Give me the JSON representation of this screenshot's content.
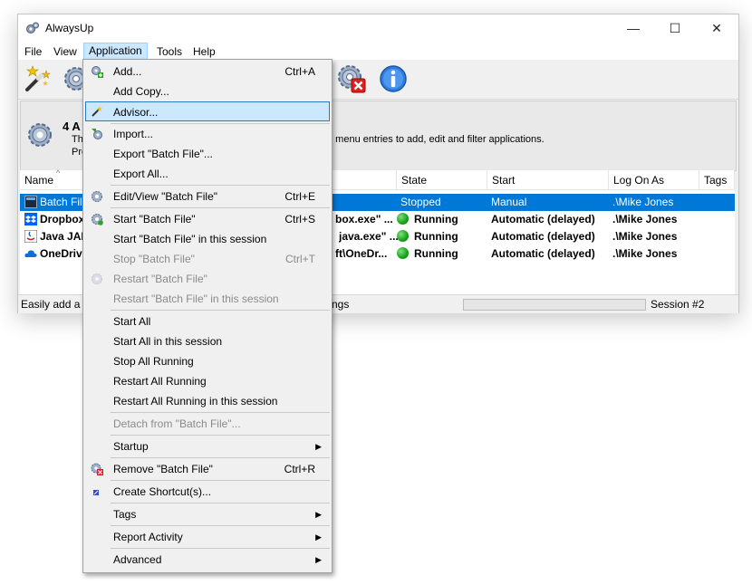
{
  "window": {
    "title": "AlwaysUp",
    "controls": [
      "—",
      "☐",
      "✕"
    ]
  },
  "menubar": [
    "File",
    "View",
    "Application",
    "Tools",
    "Help"
  ],
  "toolbar_icons": [
    "magic-wand-icon",
    "gear-add-icon",
    "gear-remove-icon",
    "info-icon"
  ],
  "info_panel": {
    "title": "4 A",
    "line1": "Th",
    "line2": "Pre",
    "text": "d menu entries to add, edit and filter applications."
  },
  "list": {
    "columns": [
      "Name",
      "State",
      "Start",
      "Log On As",
      "Tags"
    ],
    "rows": [
      {
        "name": "Batch File",
        "mid": "",
        "state": "Stopped",
        "start": "Manual",
        "logon": ".\\Mike Jones",
        "running": false
      },
      {
        "name": "Dropbox",
        "mid": "box.exe\" ...",
        "state": "Running",
        "start": "Automatic (delayed)",
        "logon": ".\\Mike Jones",
        "running": true
      },
      {
        "name": "Java JAR",
        "mid": "java.exe\" ...",
        "state": "Running",
        "start": "Automatic (delayed)",
        "logon": ".\\Mike Jones",
        "running": true
      },
      {
        "name": "OneDriv",
        "mid": "ft\\OneDr...",
        "state": "Running",
        "start": "Automatic (delayed)",
        "logon": ".\\Mike Jones",
        "running": true
      }
    ]
  },
  "statusbar": {
    "left": "Easily add a w",
    "mid": "ngs",
    "session": "Session #2"
  },
  "context_menu": {
    "items": [
      {
        "label": "Add...",
        "shortcut": "Ctrl+A",
        "icon": "gear-add-icon"
      },
      {
        "label": "Add Copy..."
      },
      {
        "label": "Advisor...",
        "icon": "magic-wand-icon",
        "highlighted": true
      },
      {
        "label": "Import...",
        "icon": "import-icon"
      },
      {
        "label": "Export \"Batch File\"..."
      },
      {
        "label": "Export All..."
      },
      {
        "label": "Edit/View \"Batch File\"",
        "shortcut": "Ctrl+E",
        "icon": "gear-edit-icon"
      },
      {
        "label": "Start \"Batch File\"",
        "shortcut": "Ctrl+S",
        "icon": "gear-start-icon"
      },
      {
        "label": "Start \"Batch File\" in this session"
      },
      {
        "label": "Stop \"Batch File\"",
        "shortcut": "Ctrl+T",
        "disabled": true
      },
      {
        "label": "Restart \"Batch File\"",
        "disabled": true,
        "icon": "gear-restart-icon"
      },
      {
        "label": "Restart \"Batch File\" in this session",
        "disabled": true
      },
      {
        "label": "Start All"
      },
      {
        "label": "Start All in this session"
      },
      {
        "label": "Stop All Running"
      },
      {
        "label": "Restart All Running"
      },
      {
        "label": "Restart All Running in this session"
      },
      {
        "label": "Detach from \"Batch File\"...",
        "disabled": true
      },
      {
        "label": "Startup",
        "submenu": true
      },
      {
        "label": "Remove \"Batch File\"",
        "shortcut": "Ctrl+R",
        "icon": "gear-remove-icon"
      },
      {
        "label": "Create Shortcut(s)...",
        "icon": "shortcut-icon"
      },
      {
        "label": "Tags",
        "submenu": true
      },
      {
        "label": "Report Activity",
        "submenu": true
      },
      {
        "label": "Advanced",
        "submenu": true
      }
    ],
    "submenu_arrow": "▶"
  },
  "colors": {
    "selection": "#0078d7",
    "menu_highlight": "#cce8ff",
    "running": "#16a016"
  }
}
